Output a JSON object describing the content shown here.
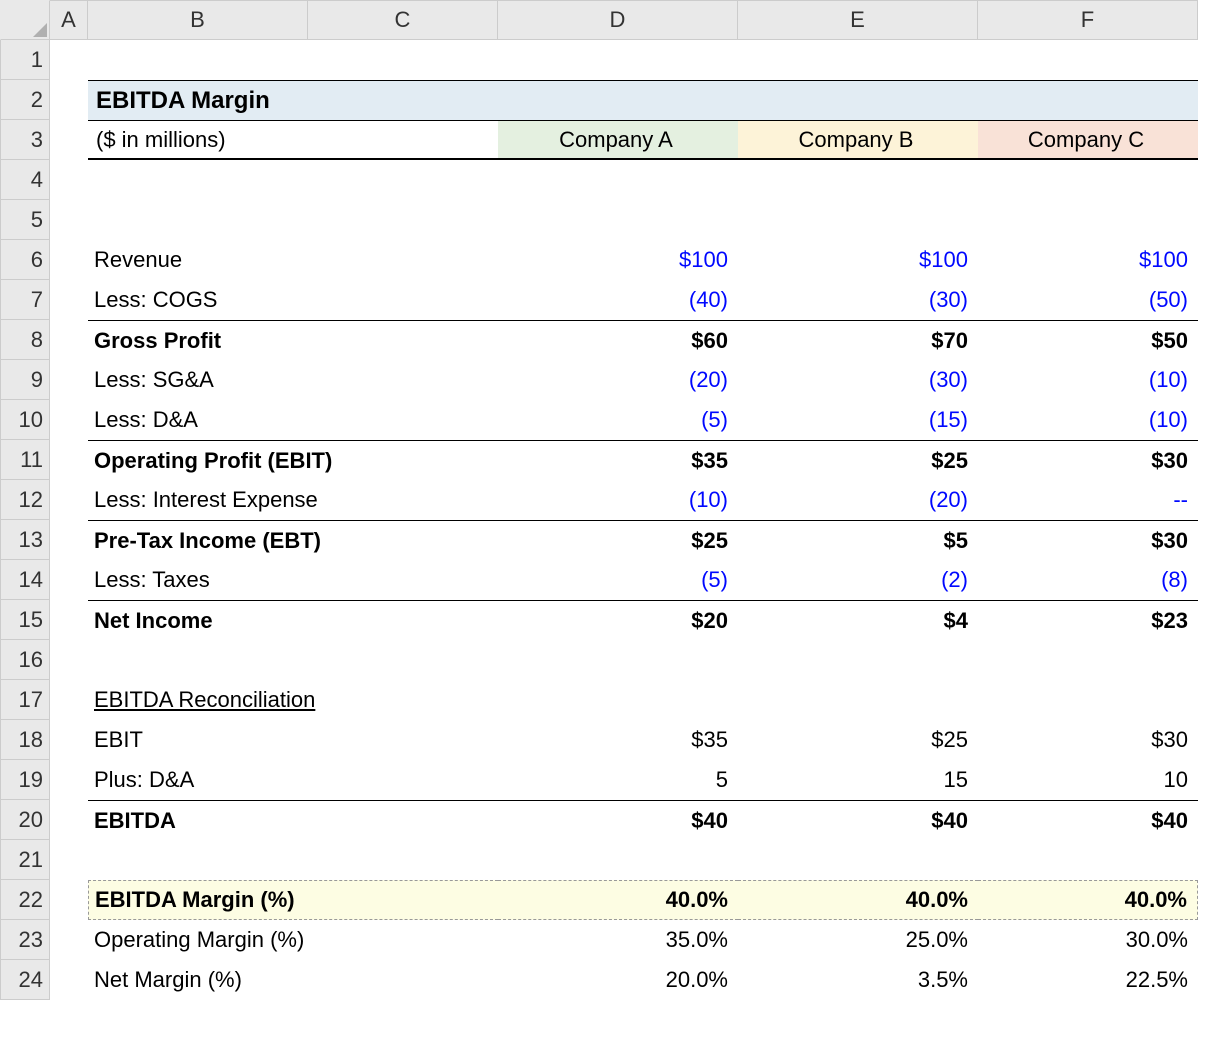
{
  "columns": [
    "A",
    "B",
    "C",
    "D",
    "E",
    "F"
  ],
  "title": "EBITDA Margin",
  "units": "($ in millions)",
  "companies": [
    "Company A",
    "Company B",
    "Company C"
  ],
  "rows": {
    "revenue": {
      "label": "Revenue",
      "vals": [
        "$100",
        "$100",
        "$100"
      ],
      "blue": true
    },
    "cogs": {
      "label": "Less: COGS",
      "vals": [
        "(40)",
        "(30)",
        "(50)"
      ],
      "blue": true
    },
    "gross": {
      "label": "Gross Profit",
      "vals": [
        "$60",
        "$70",
        "$50"
      ],
      "bold": true,
      "btop": true
    },
    "sga": {
      "label": "Less: SG&A",
      "vals": [
        "(20)",
        "(30)",
        "(10)"
      ],
      "blue": true
    },
    "da": {
      "label": "Less: D&A",
      "vals": [
        "(5)",
        "(15)",
        "(10)"
      ],
      "blue": true
    },
    "ebit": {
      "label": "Operating Profit (EBIT)",
      "vals": [
        "$35",
        "$25",
        "$30"
      ],
      "bold": true,
      "btop": true
    },
    "intexp": {
      "label": "Less: Interest Expense",
      "vals": [
        "(10)",
        "(20)",
        "--"
      ],
      "blue": true
    },
    "ebt": {
      "label": "Pre-Tax Income (EBT)",
      "vals": [
        "$25",
        "$5",
        "$30"
      ],
      "bold": true,
      "btop": true
    },
    "taxes": {
      "label": "Less: Taxes",
      "vals": [
        "(5)",
        "(2)",
        "(8)"
      ],
      "blue": true
    },
    "netincome": {
      "label": "Net Income",
      "vals": [
        "$20",
        "$4",
        "$23"
      ],
      "bold": true,
      "btop": true
    },
    "recon_header": {
      "label": "EBITDA Reconciliation"
    },
    "recon_ebit": {
      "label": "EBIT",
      "vals": [
        "$35",
        "$25",
        "$30"
      ]
    },
    "recon_da": {
      "label": "Plus: D&A",
      "vals": [
        "5",
        "15",
        "10"
      ]
    },
    "ebitda": {
      "label": "EBITDA",
      "vals": [
        "$40",
        "$40",
        "$40"
      ],
      "bold": true,
      "btop": true
    },
    "ebitda_margin": {
      "label": "EBITDA Margin (%)",
      "vals": [
        "40.0%",
        "40.0%",
        "40.0%"
      ],
      "bold": true,
      "hl": true
    },
    "op_margin": {
      "label": "Operating Margin (%)",
      "vals": [
        "35.0%",
        "25.0%",
        "30.0%"
      ]
    },
    "net_margin": {
      "label": "Net Margin (%)",
      "vals": [
        "20.0%",
        "3.5%",
        "22.5%"
      ]
    }
  },
  "chart_data": {
    "type": "table",
    "title": "EBITDA Margin",
    "units": "$ in millions",
    "categories": [
      "Company A",
      "Company B",
      "Company C"
    ],
    "series": [
      {
        "name": "Revenue",
        "values": [
          100,
          100,
          100
        ]
      },
      {
        "name": "Less: COGS",
        "values": [
          -40,
          -30,
          -50
        ]
      },
      {
        "name": "Gross Profit",
        "values": [
          60,
          70,
          50
        ]
      },
      {
        "name": "Less: SG&A",
        "values": [
          -20,
          -30,
          -10
        ]
      },
      {
        "name": "Less: D&A",
        "values": [
          -5,
          -15,
          -10
        ]
      },
      {
        "name": "Operating Profit (EBIT)",
        "values": [
          35,
          25,
          30
        ]
      },
      {
        "name": "Less: Interest Expense",
        "values": [
          -10,
          -20,
          null
        ]
      },
      {
        "name": "Pre-Tax Income (EBT)",
        "values": [
          25,
          5,
          30
        ]
      },
      {
        "name": "Less: Taxes",
        "values": [
          -5,
          -2,
          -8
        ]
      },
      {
        "name": "Net Income",
        "values": [
          20,
          4,
          23
        ]
      },
      {
        "name": "EBIT (reconciliation)",
        "values": [
          35,
          25,
          30
        ]
      },
      {
        "name": "Plus: D&A",
        "values": [
          5,
          15,
          10
        ]
      },
      {
        "name": "EBITDA",
        "values": [
          40,
          40,
          40
        ]
      },
      {
        "name": "EBITDA Margin (%)",
        "values": [
          40.0,
          40.0,
          40.0
        ]
      },
      {
        "name": "Operating Margin (%)",
        "values": [
          35.0,
          25.0,
          30.0
        ]
      },
      {
        "name": "Net Margin (%)",
        "values": [
          20.0,
          3.5,
          22.5
        ]
      }
    ]
  }
}
